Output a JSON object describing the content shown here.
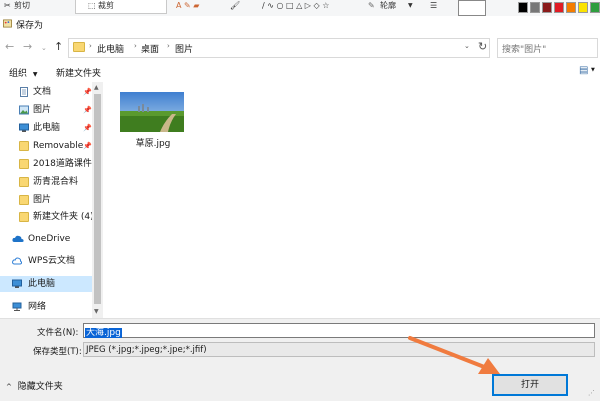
{
  "paint_ribbon": {
    "cut_label": "剪切",
    "crop_label": "裁剪",
    "outline_label": "轮廓"
  },
  "window": {
    "title": "保存为"
  },
  "address": {
    "segments": [
      "此电脑",
      "桌面",
      "图片"
    ],
    "search_placeholder": "搜索\"图片\""
  },
  "toolbar": {
    "organize_label": "组织",
    "new_folder_label": "新建文件夹"
  },
  "sidebar": {
    "items": [
      {
        "label": "文档",
        "icon": "document-icon",
        "pinned": true
      },
      {
        "label": "图片",
        "icon": "pictures-icon",
        "pinned": true
      },
      {
        "label": "此电脑",
        "icon": "computer-icon",
        "pinned": true
      },
      {
        "label": "Removable",
        "icon": "folder-icon",
        "pinned": true
      },
      {
        "label": "2018道路课件",
        "icon": "folder-icon",
        "pinned": false
      },
      {
        "label": "沥青混合料",
        "icon": "folder-icon",
        "pinned": false
      },
      {
        "label": "图片",
        "icon": "folder-icon",
        "pinned": false
      },
      {
        "label": "新建文件夹 (4)",
        "icon": "folder-icon",
        "pinned": false
      },
      {
        "label": "OneDrive",
        "icon": "cloud-icon",
        "pinned": false
      },
      {
        "label": "WPS云文档",
        "icon": "wps-cloud-icon",
        "pinned": false
      },
      {
        "label": "此电脑",
        "icon": "computer-icon",
        "pinned": false,
        "selected": true
      },
      {
        "label": "网络",
        "icon": "network-icon",
        "pinned": false
      }
    ]
  },
  "files": [
    {
      "name": "草原.jpg",
      "type": "image"
    }
  ],
  "form": {
    "filename_label": "文件名(N):",
    "filename_value": "大海.jpg",
    "filetype_label": "保存类型(T):",
    "filetype_value": "JPEG (*.jpg;*.jpeg;*.jpe;*.jfif)",
    "open_button": "打开",
    "hide_folders_label": "隐藏文件夹"
  },
  "colors": {
    "accent": "#0078d7",
    "selection": "#cce8ff",
    "arrow": "#f07b3f"
  }
}
